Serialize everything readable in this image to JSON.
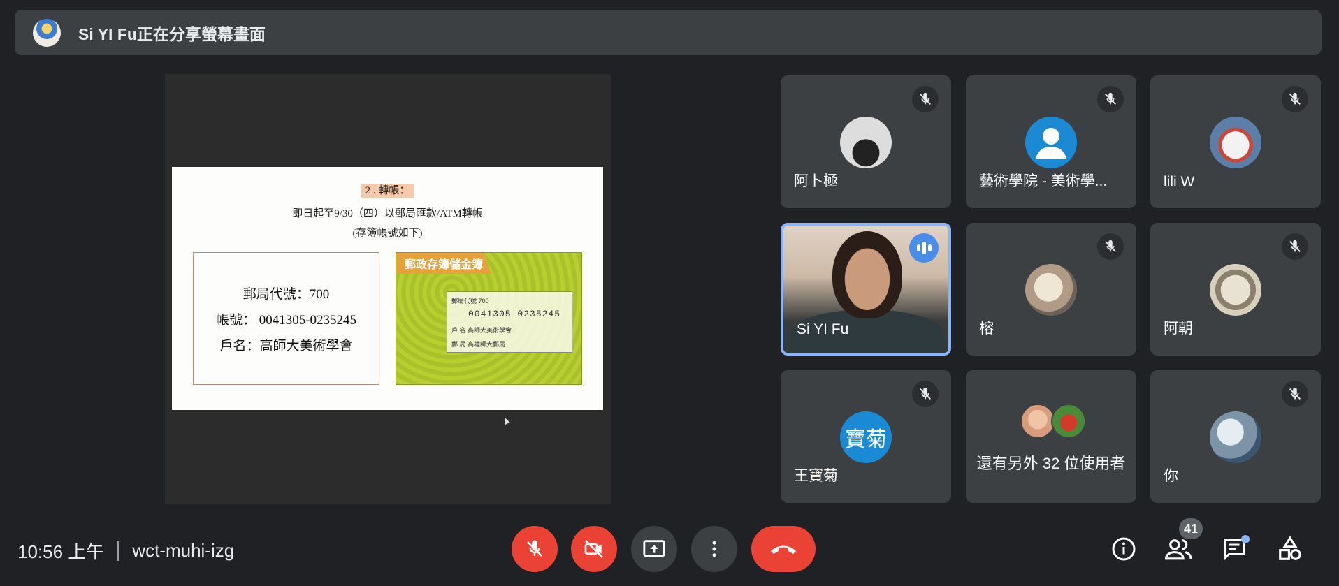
{
  "banner": {
    "text": "Si YI Fu正在分享螢幕畫面"
  },
  "slide": {
    "heading": "2 . 轉帳：",
    "line1": "即日起至9/30（四）以郵局匯款/ATM轉帳",
    "line2": "(存簿帳號如下)",
    "post_code": "郵局代號：700",
    "account_no": "帳號： 0041305-0235245",
    "account_name": "戶名：高師大美術學會",
    "passbook_title": "郵政存簿儲金簿",
    "passbook_row1": "郵局代號  700",
    "passbook_nums": "0041305  0235245",
    "passbook_row_name": "戶  名   高師大美術學會",
    "passbook_row_office": "郵  局   高雄師大郵局"
  },
  "participants": [
    {
      "name": "阿卜極",
      "muted": true
    },
    {
      "name": "藝術學院 - 美術學...",
      "muted": true
    },
    {
      "name": "lili W",
      "muted": true
    },
    {
      "name": "Si YI Fu",
      "speaking": true
    },
    {
      "name": "榕",
      "muted": true
    },
    {
      "name": "阿朝",
      "muted": true
    },
    {
      "name": "王寶菊",
      "initials": "寶菊",
      "muted": true
    },
    {
      "name": "還有另外 32 位使用者"
    },
    {
      "name": "你",
      "muted": true
    }
  ],
  "meeting": {
    "time": "10:56 上午",
    "code": "wct-muhi-izg",
    "participant_count": "41"
  },
  "icons": {
    "mic": "mic-off-icon",
    "camera": "videocam-off-icon",
    "present": "present-screen-icon",
    "more": "more-vert-icon",
    "hangup": "call-end-icon",
    "info": "info-icon",
    "people": "people-icon",
    "chat": "chat-icon",
    "activities": "activities-icon"
  },
  "colors": {
    "background": "#202124",
    "tile": "#3c4043",
    "red": "#ea4335",
    "accent": "#8ab4f8",
    "avatar_blue": "#1a8ad4"
  }
}
